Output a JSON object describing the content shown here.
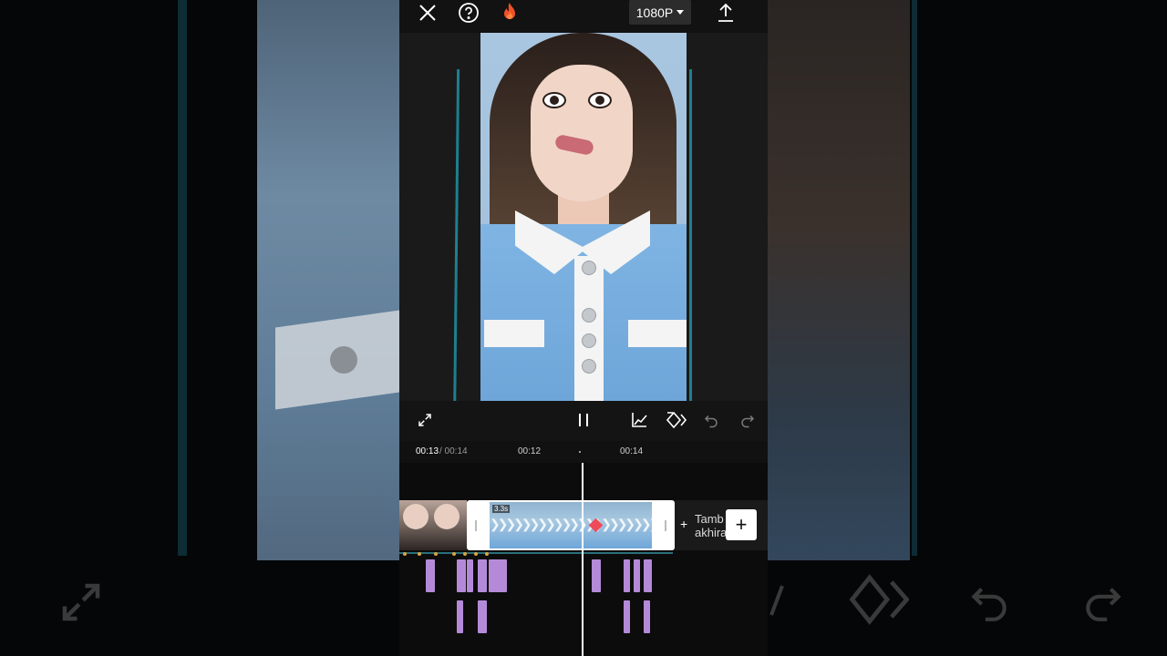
{
  "toolbar": {
    "resolution": "1080P",
    "close_icon": "close-icon",
    "help_icon": "help-icon",
    "pro_icon": "flame-icon",
    "export_icon": "export-upload-icon"
  },
  "controls": {
    "fullscreen_icon": "fullscreen-icon",
    "play_pause_icon": "pause-icon",
    "graph_icon": "graph-icon",
    "keyframe_icon": "keyframe-icon",
    "undo_icon": "undo-icon",
    "redo_icon": "redo-icon"
  },
  "ruler": {
    "current": "00:13",
    "total": "/ 00:14",
    "ticks": [
      "00:12",
      "00:14"
    ]
  },
  "timeline": {
    "selected_clip_duration": "3.3s",
    "add_end_label_line1": "Tamb",
    "add_end_label_line2": "akhira",
    "add_plus_small": "+",
    "add_button": "+"
  },
  "colors": {
    "accent_guide": "#1e7f8f",
    "keyframe": "#f04a5a",
    "audio_segment": "#b48ad8"
  }
}
